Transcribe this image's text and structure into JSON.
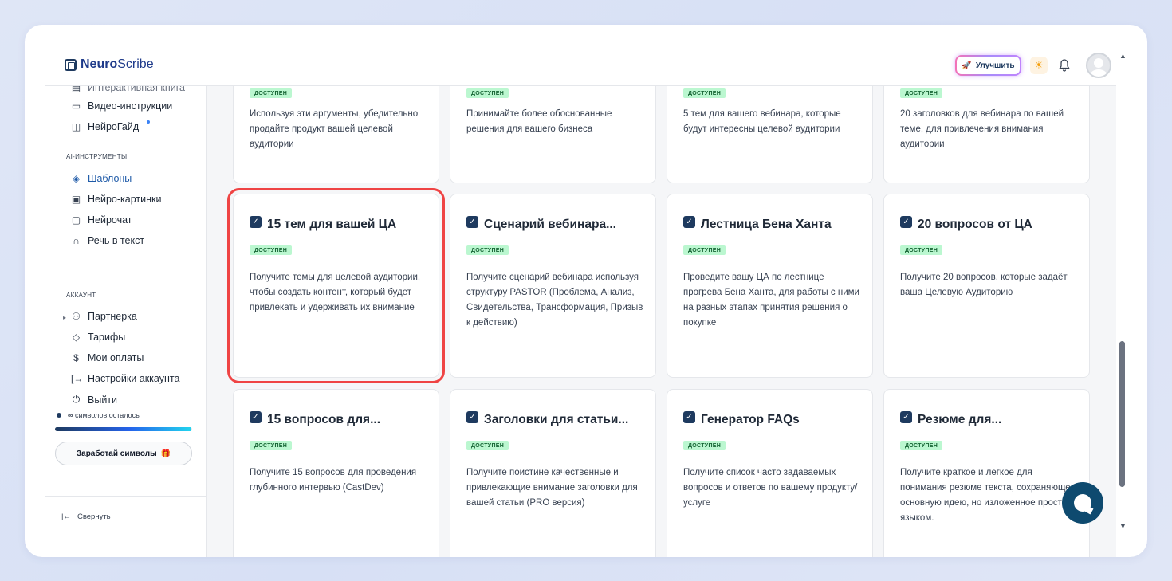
{
  "header": {
    "logo_bold": "Neuro",
    "logo_light": "Scribe",
    "upgrade_label": "Улучшить"
  },
  "sidebar": {
    "cut_item": "Интерактивная книга",
    "items_top": [
      {
        "label": "Видео-инструкции",
        "icon": "video-icon"
      },
      {
        "label": "НейроГайд",
        "icon": "book-icon"
      }
    ],
    "section_ai": "AI-ИНСТРУМЕНТЫ",
    "items_ai": [
      {
        "label": "Шаблоны",
        "icon": "layers-icon"
      },
      {
        "label": "Нейро-картинки",
        "icon": "image-icon"
      },
      {
        "label": "Нейрочат",
        "icon": "chat-icon"
      },
      {
        "label": "Речь в текст",
        "icon": "headphones-icon"
      }
    ],
    "section_account": "АККАУНТ",
    "items_account": [
      {
        "label": "Партнерка",
        "icon": "users-icon"
      },
      {
        "label": "Тарифы",
        "icon": "tag-icon"
      },
      {
        "label": "Мои оплаты",
        "icon": "dollar-icon"
      },
      {
        "label": "Настройки аккаунта",
        "icon": "settings-icon"
      },
      {
        "label": "Выйти",
        "icon": "power-icon"
      }
    ],
    "symbols_infinity": "∞",
    "symbols_label": "символов осталось",
    "symbols_fraction": 0.99,
    "earn_label": "Заработай символы",
    "collapse_label": "Свернуть"
  },
  "cards_top": [
    {
      "badge": "ДОСТУПЕН",
      "desc": "Используя эти аргументы, убедительно продайте продукт вашей целевой аудитории"
    },
    {
      "badge": "ДОСТУПЕН",
      "desc": "Принимайте более обоснованные решения для вашего бизнеса"
    },
    {
      "badge": "ДОСТУПЕН",
      "desc": "5 тем для вашего вебинара, которые будут интересны целевой аудитории"
    },
    {
      "badge": "ДОСТУПЕН",
      "desc": "20 заголовков для вебинара по вашей теме, для привлечения внимания аудитории"
    }
  ],
  "cards_mid": [
    {
      "title": "15 тем для вашей ЦА",
      "badge": "ДОСТУПЕН",
      "desc": "Получите темы для целевой аудитории, чтобы создать контент, который будет привлекать и удерживать их внимание"
    },
    {
      "title": "Сценарий вебинара...",
      "badge": "ДОСТУПЕН",
      "desc": "Получите сценарий вебинара используя структуру PASTOR (Проблема, Анализ, Свидетельства, Трансформация, Призыв к действию)"
    },
    {
      "title": "Лестница Бена Ханта",
      "badge": "ДОСТУПЕН",
      "desc": "Проведите вашу ЦА по лестнице прогрева Бена Ханта, для работы с ними на разных этапах принятия решения о покупке"
    },
    {
      "title": "20 вопросов от ЦА",
      "badge": "ДОСТУПЕН",
      "desc": "Получите 20 вопросов, которые задаёт ваша Целевую Аудиторию"
    }
  ],
  "cards_bot": [
    {
      "title": "15 вопросов для...",
      "badge": "ДОСТУПЕН",
      "desc": "Получите 15 вопросов для проведения глубинного интервью (CastDev)"
    },
    {
      "title": "Заголовки для статьи...",
      "badge": "ДОСТУПЕН",
      "desc": "Получите поистине качественные и привлекающие внимание заголовки для вашей статьи (PRO версия)"
    },
    {
      "title": "Генератор FAQs",
      "badge": "ДОСТУПЕН",
      "desc": "Получите список часто задаваемых вопросов и ответов по вашему продукту/услуге"
    },
    {
      "title": "Резюме для...",
      "badge": "ДОСТУПЕН",
      "desc": "Получите краткое и легкое для понимания резюме текста, сохраняющее основную идею, но изложенное простым языком."
    }
  ],
  "colors": {
    "accent": "#1e3a5f",
    "badge_bg": "#bbf7d0",
    "highlight": "#ef4444"
  }
}
